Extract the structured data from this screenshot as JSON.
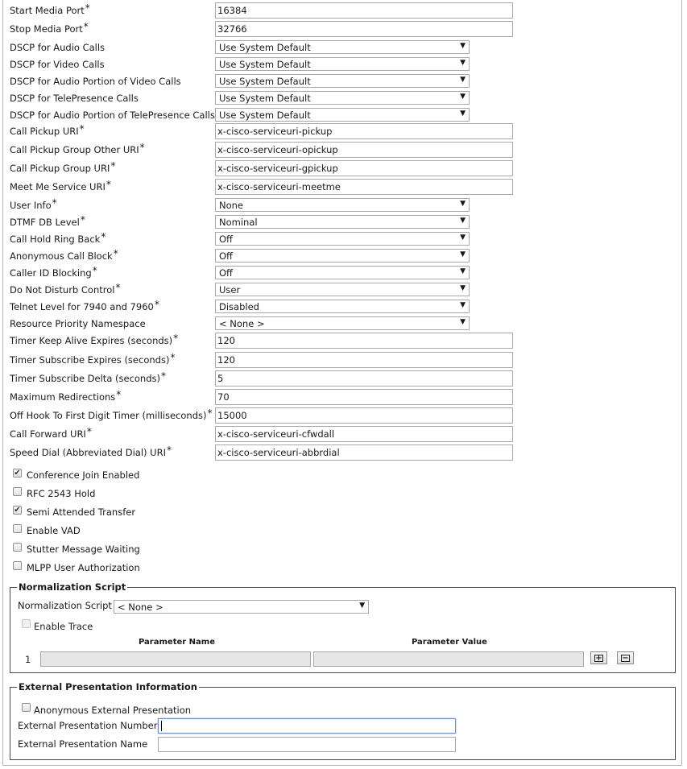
{
  "fields": [
    {
      "label": "Start Media Port",
      "required": true,
      "type": "text",
      "value": "16384"
    },
    {
      "label": "Stop Media Port",
      "required": true,
      "type": "text",
      "value": "32766"
    },
    {
      "label": "DSCP for Audio Calls",
      "required": false,
      "type": "select",
      "value": "Use System Default"
    },
    {
      "label": "DSCP for Video Calls",
      "required": false,
      "type": "select",
      "value": "Use System Default"
    },
    {
      "label": "DSCP for Audio Portion of Video Calls",
      "required": false,
      "type": "select",
      "value": "Use System Default"
    },
    {
      "label": "DSCP for TelePresence Calls",
      "required": false,
      "type": "select",
      "value": "Use System Default"
    },
    {
      "label": "DSCP for Audio Portion of TelePresence Calls",
      "required": false,
      "type": "select",
      "value": "Use System Default"
    },
    {
      "label": "Call Pickup URI",
      "required": true,
      "type": "text",
      "value": "x-cisco-serviceuri-pickup"
    },
    {
      "label": "Call Pickup Group Other URI",
      "required": true,
      "type": "text",
      "value": "x-cisco-serviceuri-opickup"
    },
    {
      "label": "Call Pickup Group URI",
      "required": true,
      "type": "text",
      "value": "x-cisco-serviceuri-gpickup"
    },
    {
      "label": "Meet Me Service URI",
      "required": true,
      "type": "text",
      "value": "x-cisco-serviceuri-meetme"
    },
    {
      "label": "User Info",
      "required": true,
      "type": "select",
      "value": "None"
    },
    {
      "label": "DTMF DB Level",
      "required": true,
      "type": "select",
      "value": "Nominal"
    },
    {
      "label": "Call Hold Ring Back",
      "required": true,
      "type": "select",
      "value": "Off"
    },
    {
      "label": "Anonymous Call Block",
      "required": true,
      "type": "select",
      "value": "Off"
    },
    {
      "label": "Caller ID Blocking",
      "required": true,
      "type": "select",
      "value": "Off"
    },
    {
      "label": "Do Not Disturb Control",
      "required": true,
      "type": "select",
      "value": "User"
    },
    {
      "label": "Telnet Level for 7940 and 7960",
      "required": true,
      "type": "select",
      "value": "Disabled"
    },
    {
      "label": "Resource Priority Namespace",
      "required": false,
      "type": "select",
      "value": "< None >"
    },
    {
      "label": "Timer Keep Alive Expires (seconds)",
      "required": true,
      "type": "text",
      "value": "120"
    },
    {
      "label": "Timer Subscribe Expires (seconds)",
      "required": true,
      "type": "text",
      "value": "120"
    },
    {
      "label": "Timer Subscribe Delta (seconds)",
      "required": true,
      "type": "text",
      "value": "5"
    },
    {
      "label": "Maximum Redirections",
      "required": true,
      "type": "text",
      "value": "70"
    },
    {
      "label": "Off Hook To First Digit Timer (milliseconds)",
      "required": true,
      "type": "text",
      "value": "15000"
    },
    {
      "label": "Call Forward URI",
      "required": true,
      "type": "text",
      "value": "x-cisco-serviceuri-cfwdall"
    },
    {
      "label": "Speed Dial (Abbreviated Dial) URI",
      "required": true,
      "type": "text",
      "value": "x-cisco-serviceuri-abbrdial"
    }
  ],
  "required_mark": "*",
  "checkboxes": [
    {
      "label": "Conference Join Enabled",
      "checked": true
    },
    {
      "label": "RFC 2543 Hold",
      "checked": false
    },
    {
      "label": "Semi Attended Transfer",
      "checked": true
    },
    {
      "label": "Enable VAD",
      "checked": false
    },
    {
      "label": "Stutter Message Waiting",
      "checked": false
    },
    {
      "label": "MLPP User Authorization",
      "checked": false
    }
  ],
  "normalization": {
    "legend": "Normalization Script",
    "script_label": "Normalization Script",
    "script_value": "< None >",
    "enable_trace_label": "Enable Trace",
    "enable_trace_checked": false,
    "col_param_name": "Parameter Name",
    "col_param_value": "Parameter Value",
    "row_index": "1",
    "add_symbol": "+",
    "remove_symbol": "−"
  },
  "external": {
    "legend": "External Presentation Information",
    "anonymous_label": "Anonymous External Presentation",
    "anonymous_checked": false,
    "number_label": "External Presentation Number",
    "number_value": "",
    "name_label": "External Presentation Name",
    "name_value": ""
  },
  "icons": {
    "dropdown": "▼",
    "check": "✔"
  }
}
